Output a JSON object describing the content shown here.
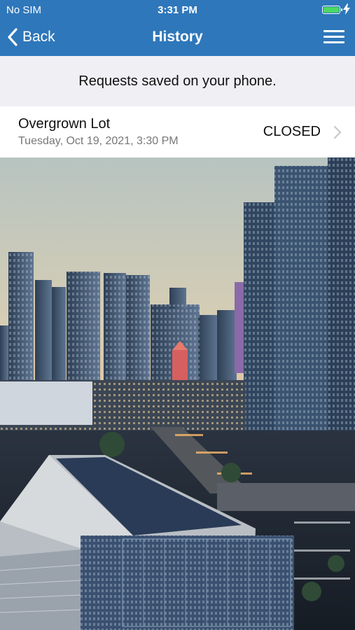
{
  "status_bar": {
    "carrier": "No SIM",
    "time": "3:31 PM",
    "battery_fill_fraction": 1.0,
    "battery_color": "#4cd964"
  },
  "nav": {
    "back_label": "Back",
    "title": "History",
    "accent": "#2e77ba"
  },
  "banner": {
    "text": "Requests saved on your phone."
  },
  "requests": [
    {
      "name": "Overgrown Lot",
      "date": "Tuesday, Oct 19, 2021, 3:30 PM",
      "status": "CLOSED"
    }
  ],
  "icons": [
    "back-chevron-icon",
    "hamburger-menu-icon",
    "battery-icon",
    "charging-bolt-icon",
    "chevron-right-icon"
  ]
}
